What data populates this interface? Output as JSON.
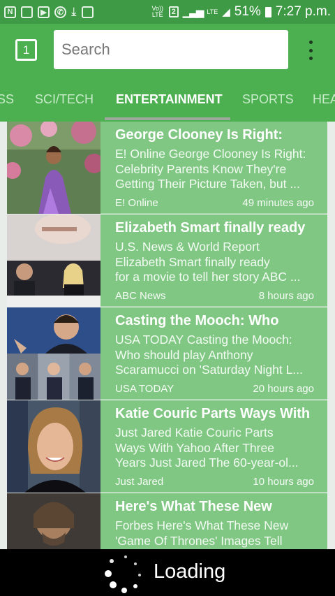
{
  "status_bar": {
    "volte": "Vo)) LTE",
    "sim": "2",
    "lte": "LTE",
    "battery": "51%",
    "time": "7:27 p.m."
  },
  "toolbar": {
    "tab_count": "1",
    "search_placeholder": "Search",
    "more_icon": "more-vertical-icon"
  },
  "tabs": [
    {
      "label": "SS"
    },
    {
      "label": "SCI/TECH"
    },
    {
      "label": "ENTERTAINMENT",
      "active": true
    },
    {
      "label": "SPORTS"
    },
    {
      "label": "HEA"
    }
  ],
  "articles": [
    {
      "headline": "George Clooney Is Right:",
      "summary": [
        "E! Online George Clooney Is Right:",
        "Celebrity Parents Know They're",
        "Getting Their Picture Taken, but ..."
      ],
      "source": "E! Online",
      "time": "49 minutes ago"
    },
    {
      "headline": "Elizabeth Smart finally ready",
      "summary": [
        "U.S. News & World Report",
        "Elizabeth Smart finally ready",
        "for a movie to tell her story ABC ..."
      ],
      "source": "ABC News",
      "time": "8 hours ago"
    },
    {
      "headline": "Casting the Mooch: Who",
      "summary": [
        "USA TODAY Casting the Mooch:",
        "Who should play Anthony",
        "Scaramucci on 'Saturday Night L..."
      ],
      "source": "USA TODAY",
      "time": "20 hours ago"
    },
    {
      "headline": "Katie Couric Parts Ways With",
      "summary": [
        "Just Jared Katie Couric Parts",
        "Ways With Yahoo After Three",
        "Years Just Jared The 60-year-ol..."
      ],
      "source": "Just Jared",
      "time": "10 hours ago"
    },
    {
      "headline": "Here's What These New",
      "summary": [
        "Forbes Here's What These New",
        "'Game Of Thrones' Images Tell",
        ""
      ],
      "source": "",
      "time": ""
    }
  ],
  "loading": {
    "text": "Loading"
  },
  "colors": {
    "status_bar": "#3f9a46",
    "toolbar": "#4caf50",
    "card": "#81c784",
    "overlay": "#000000"
  }
}
